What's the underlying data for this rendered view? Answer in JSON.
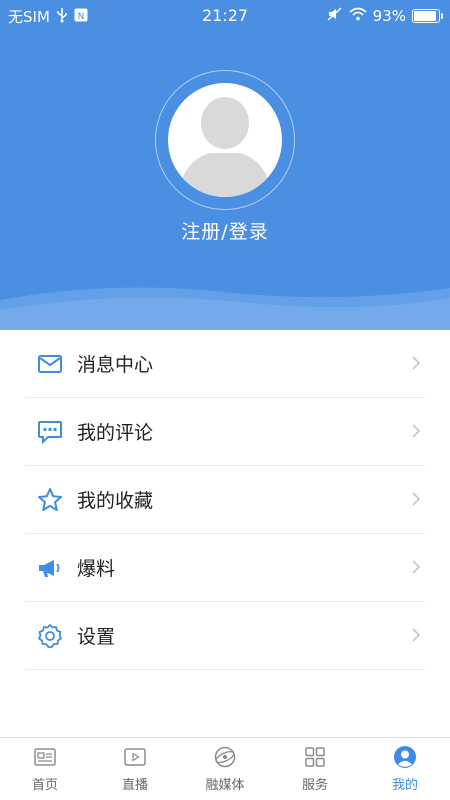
{
  "status_bar": {
    "carrier": "无SIM",
    "time": "21:27",
    "battery": "93%",
    "battery_level": 0.93
  },
  "profile": {
    "login_label": "注册/登录"
  },
  "menu": {
    "items": [
      {
        "label": "消息中心",
        "icon": "mail-icon"
      },
      {
        "label": "我的评论",
        "icon": "comment-icon"
      },
      {
        "label": "我的收藏",
        "icon": "star-icon"
      },
      {
        "label": "爆料",
        "icon": "megaphone-icon"
      },
      {
        "label": "设置",
        "icon": "gear-icon"
      }
    ]
  },
  "tabbar": {
    "tabs": [
      {
        "label": "首页",
        "icon": "newspaper-icon",
        "active": false
      },
      {
        "label": "直播",
        "icon": "play-icon",
        "active": false
      },
      {
        "label": "融媒体",
        "icon": "globe-icon",
        "active": false
      },
      {
        "label": "服务",
        "icon": "grid-icon",
        "active": false
      },
      {
        "label": "我的",
        "icon": "user-icon",
        "active": true
      }
    ]
  },
  "colors": {
    "header_bg": "#4a8fe2",
    "accent": "#3d8be6",
    "icon_blue": "#3b8ee0"
  }
}
